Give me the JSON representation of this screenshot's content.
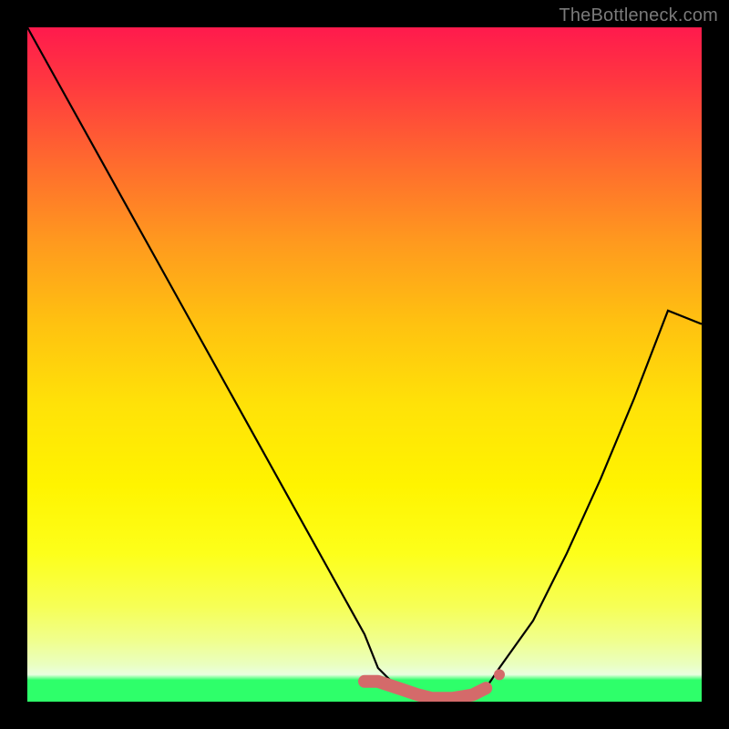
{
  "watermark": "TheBottleneck.com",
  "chart_data": {
    "type": "line",
    "title": "",
    "xlabel": "",
    "ylabel": "",
    "xlim": [
      0,
      100
    ],
    "ylim": [
      0,
      100
    ],
    "series": [
      {
        "name": "curve",
        "x": [
          0,
          5,
          10,
          15,
          20,
          25,
          30,
          35,
          40,
          45,
          50,
          52,
          55,
          58,
          60,
          63,
          66,
          68,
          70,
          75,
          80,
          85,
          90,
          95,
          100
        ],
        "values": [
          100,
          91,
          82,
          73,
          64,
          55,
          46,
          37,
          28,
          19,
          10,
          5,
          2,
          1,
          0.5,
          0.5,
          1,
          2,
          5,
          12,
          22,
          33,
          45,
          58,
          56
        ]
      }
    ],
    "highlight": {
      "name": "bottom-band",
      "color": "#d96a6a",
      "x_start": 50,
      "x_end": 69,
      "y": 1.5
    },
    "background_gradient": {
      "top": "#ff1a4d",
      "mid": "#fff400",
      "bottom_band": "#eaffc0",
      "bottom": "#2eff6a"
    }
  }
}
